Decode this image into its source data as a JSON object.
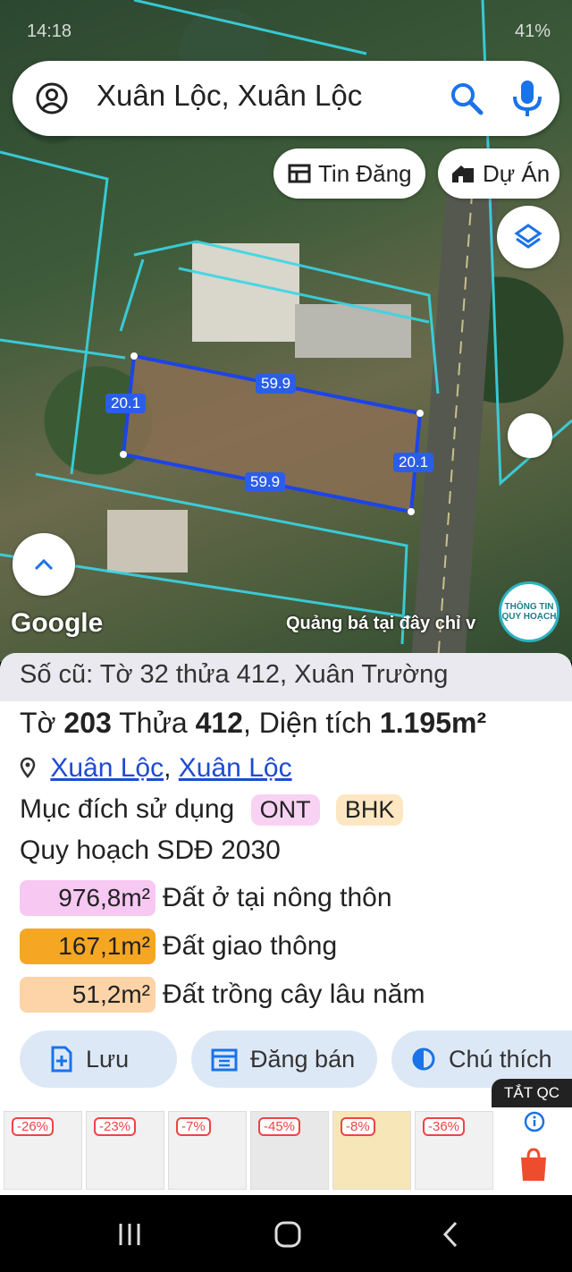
{
  "status": {
    "time": "14:18",
    "battery": "41%"
  },
  "search": {
    "query": "Xuân Lộc, Xuân Lộc"
  },
  "chips": {
    "listings": "Tin Đăng",
    "projects": "Dự Án"
  },
  "map": {
    "google": "Google",
    "promo": "Quảng bá tại đây chỉ v",
    "logo_line1": "THÔNG TIN",
    "logo_line2": "QUY HOẠCH",
    "dims": {
      "top": "59.9",
      "bottom": "59.9",
      "left": "20.1",
      "right": "20.1"
    }
  },
  "parcel": {
    "old_info": "Số cũ: Tờ 32 thửa 412, Xuân Trường",
    "sheet_label": "Tờ",
    "sheet": "203",
    "parcel_label": "Thửa",
    "parcel_no": "412",
    "area_label": ", Diện tích",
    "area": "1.195m²",
    "loc1": "Xuân Lộc",
    "loc2": "Xuân Lộc",
    "purpose_label": "Mục đích sử dụng",
    "purpose_tags": [
      "ONT",
      "BHK"
    ],
    "plan_label": "Quy hoạch SDĐ 2030",
    "zones": [
      {
        "area": "976,8m²",
        "name": "Đất ở tại nông thôn",
        "color": "#f7c8f2"
      },
      {
        "area": "167,1m²",
        "name": "Đất giao thông",
        "color": "#f5a623"
      },
      {
        "area": "51,2m²",
        "name": "Đất trồng cây lâu năm",
        "color": "#fdd3a8"
      }
    ]
  },
  "actions": {
    "save": "Lưu",
    "sell": "Đăng bán",
    "legend": "Chú thích"
  },
  "ads": {
    "close": "TẮT QC",
    "discounts": [
      "-26%",
      "-23%",
      "-7%",
      "-45%",
      "-8%",
      "-36%"
    ]
  }
}
